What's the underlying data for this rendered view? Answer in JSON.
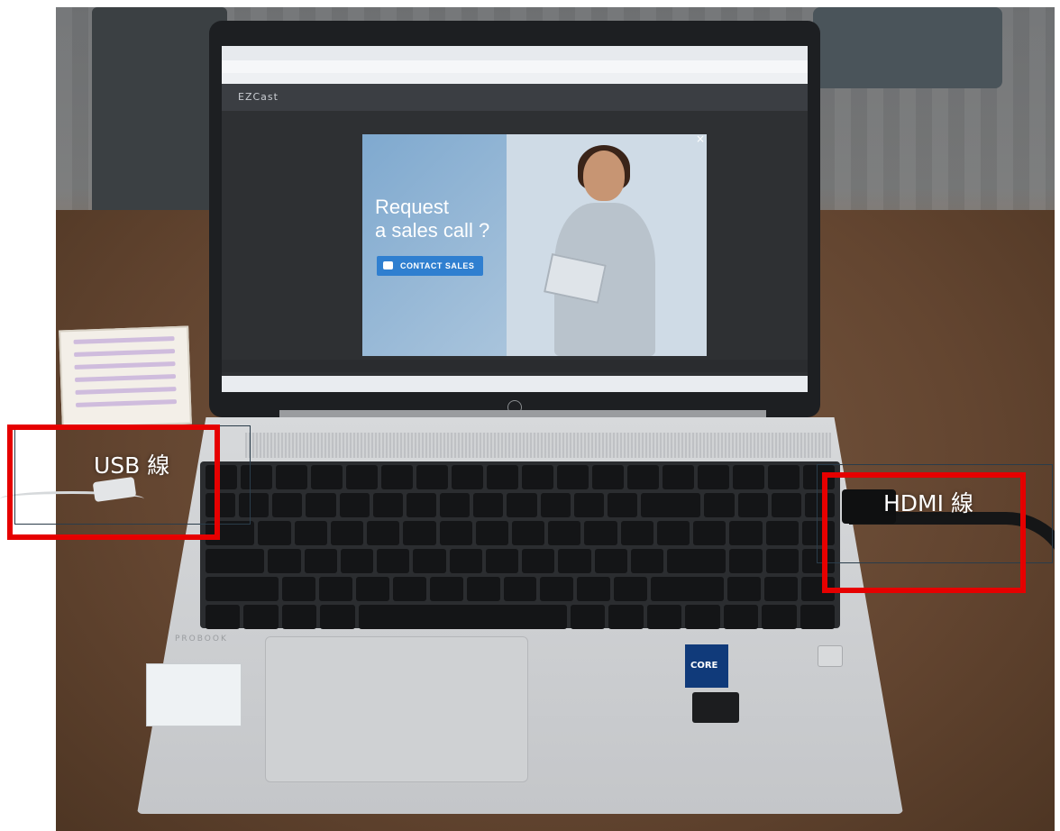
{
  "annotations": {
    "usb_label": "USB 線",
    "hdmi_label": "HDMI 線",
    "highlight_color": "#e60000",
    "frame_color": "#2a3c4a"
  },
  "screen": {
    "popup": {
      "headline_line1": "Request",
      "headline_line2": "a sales call ?",
      "cta_label": "CONTACT SALES",
      "close_symbol": "×"
    },
    "site_logo": "EZCast"
  },
  "laptop": {
    "model_text": "PROBOOK",
    "cpu_badge": "CORE"
  }
}
